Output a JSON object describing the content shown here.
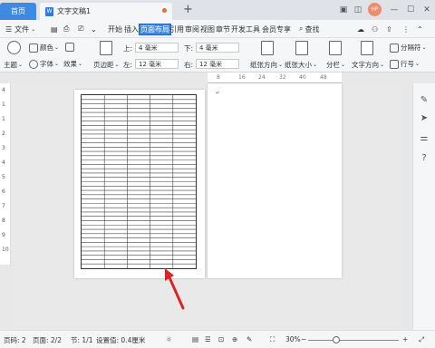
{
  "titlebar": {
    "home_tab": "首页",
    "doc_tab": "文字文稿1",
    "doc_icon": "W",
    "add_tab": "+",
    "avatar_text": "HP"
  },
  "menubar": {
    "file_label": "文件",
    "tabs": [
      "开始",
      "插入",
      "页面布局",
      "引用",
      "审阅",
      "视图",
      "章节",
      "开发工具",
      "会员专享"
    ],
    "active_tab": "页面布局",
    "search_label": "查找"
  },
  "ribbon": {
    "theme": "主题",
    "colors": "颜色",
    "fonts": "字体",
    "effects": "效果",
    "margins": "页边距",
    "margin_top_label": "上:",
    "margin_top_value": "4 毫米",
    "margin_left_label": "左:",
    "margin_left_value": "12 毫米",
    "margin_bottom_label": "下:",
    "margin_bottom_value": "4 毫米",
    "margin_right_label": "右:",
    "margin_right_value": "12 毫米",
    "orientation": "纸张方向",
    "paper_size": "纸张大小",
    "columns": "分栏",
    "text_direction": "文字方向",
    "line_numbers": "行号",
    "breaks": "分隔符"
  },
  "ruler": {
    "ticks": [
      "8",
      "16",
      "24",
      "32",
      "40",
      "48"
    ]
  },
  "vruler": {
    "chars": [
      "4",
      "1",
      "1",
      "2",
      "3",
      "4",
      "5",
      "6",
      "7",
      "8",
      "9",
      "10"
    ]
  },
  "statusbar": {
    "page": "页码: 2",
    "pages": "页面: 2/2",
    "section": "节: 1/1",
    "setting": "设置值: 0.4厘米",
    "zoom": "30%"
  },
  "table": {
    "rows": 40,
    "cols": 5
  },
  "colors": {
    "accent": "#3d8ae5",
    "arrow": "#d9262a"
  }
}
